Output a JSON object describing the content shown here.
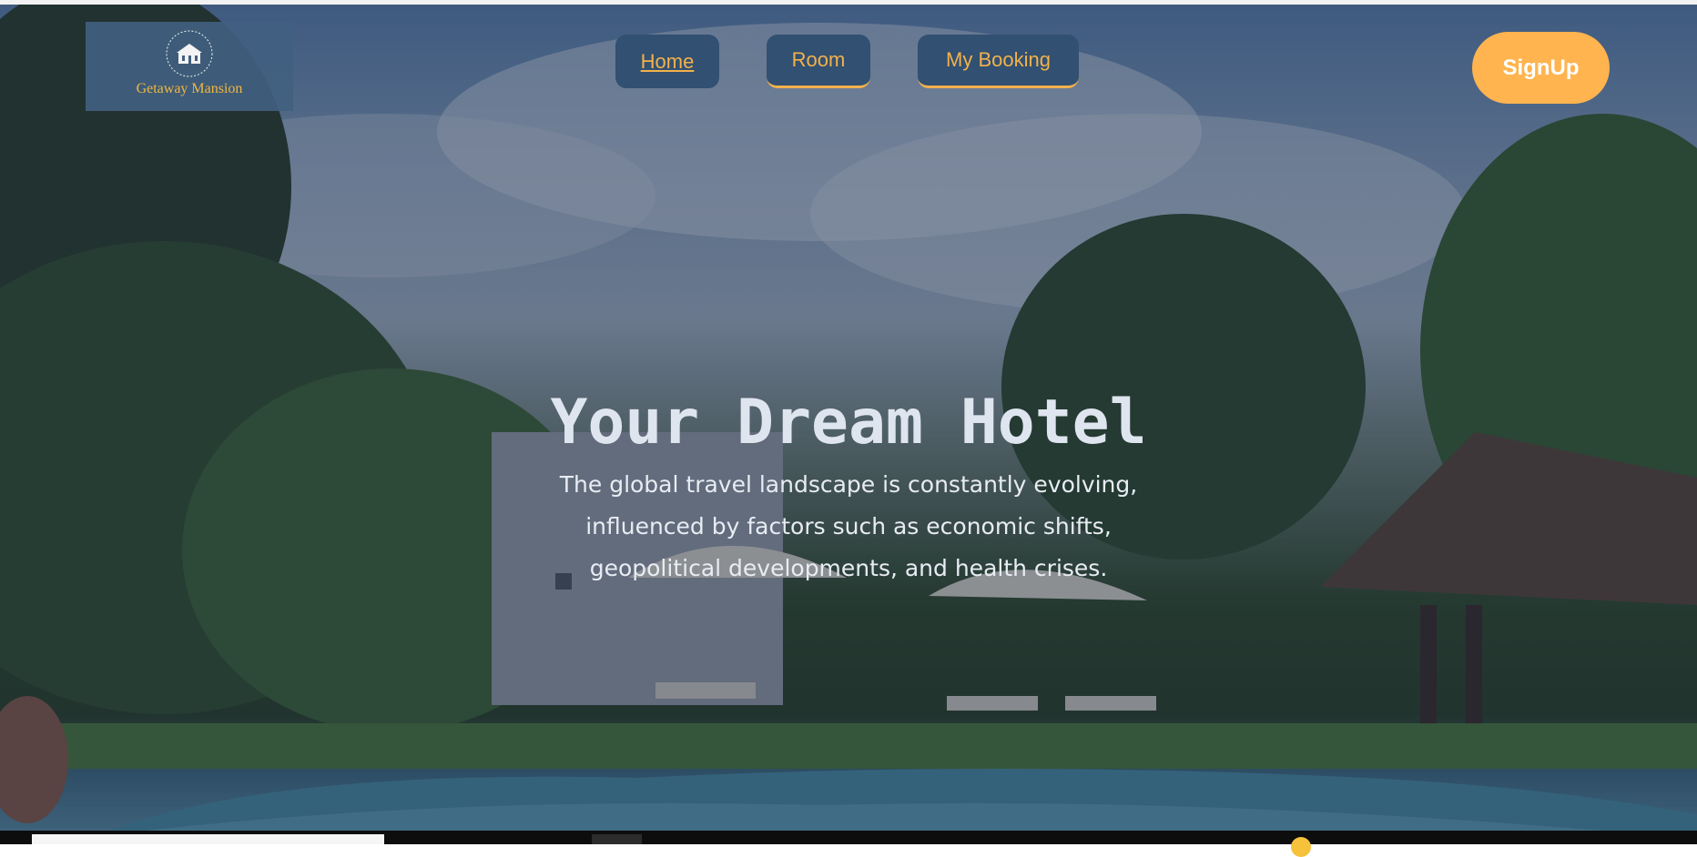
{
  "brand": {
    "name": "Getaway Mansion",
    "emblem_icon": "mansion-icon",
    "accent_color": "#f0b63f"
  },
  "nav": {
    "items": [
      {
        "label": "Home",
        "active": true
      },
      {
        "label": "Room"
      },
      {
        "label": "My Booking"
      }
    ],
    "signup_label": "SignUp",
    "button_color": "#325071",
    "signup_color": "#ffb44f"
  },
  "hero": {
    "title": "Your Dream Hotel",
    "description": "The global travel landscape is constantly evolving, influenced by factors such as economic shifts, geopolitical developments, and health crises."
  }
}
